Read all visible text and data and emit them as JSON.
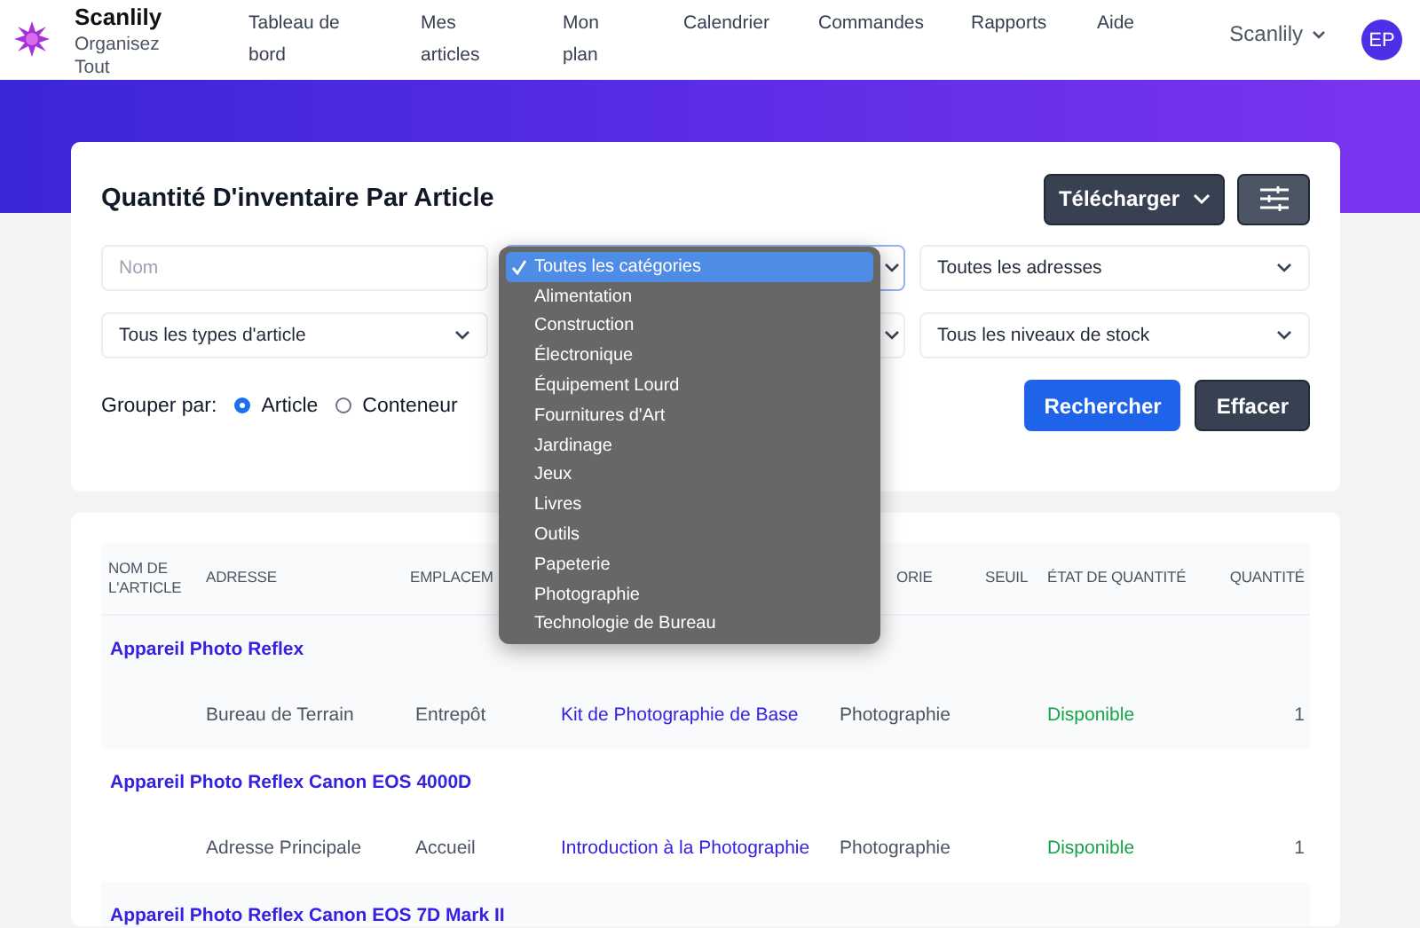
{
  "brand": {
    "name": "Scanlily",
    "tagline": "Organisez Tout"
  },
  "nav": [
    "Tableau de bord",
    "Mes articles",
    "Mon plan",
    "Calendrier",
    "Commandes",
    "Rapports",
    "Aide"
  ],
  "account": {
    "name": "Scanlily",
    "initials": "EP"
  },
  "report": {
    "title": "Quantité D'inventaire Par Article",
    "download": "Télécharger",
    "name_field": {
      "placeholder": "Nom"
    },
    "selects": [
      "Toutes les adresses",
      "Tous les types d'article",
      "Tous les niveaux de stock"
    ],
    "group_label": "Grouper par:",
    "group_options": [
      {
        "label": "Article",
        "selected": true
      },
      {
        "label": "Conteneur",
        "selected": false
      }
    ],
    "search": "Rechercher",
    "clear": "Effacer"
  },
  "category_menu": [
    {
      "label": "Toutes les catégories",
      "selected": true
    },
    {
      "label": "Alimentation",
      "selected": false
    },
    {
      "label": "Construction",
      "selected": false
    },
    {
      "label": "Électronique",
      "selected": false
    },
    {
      "label": "Équipement Lourd",
      "selected": false
    },
    {
      "label": "Fournitures d'Art",
      "selected": false
    },
    {
      "label": "Jardinage",
      "selected": false
    },
    {
      "label": "Jeux",
      "selected": false
    },
    {
      "label": "Livres",
      "selected": false
    },
    {
      "label": "Outils",
      "selected": false
    },
    {
      "label": "Papeterie",
      "selected": false
    },
    {
      "label": "Photographie",
      "selected": false
    },
    {
      "label": "Technologie de Bureau",
      "selected": false
    }
  ],
  "table": {
    "columns": [
      "NOM DE L'ARTICLE",
      "ADRESSE",
      "EMPLACEM",
      "",
      "ORIE",
      "SEUIL",
      "ÉTAT DE QUANTITÉ",
      "QUANTITÉ"
    ],
    "groups": [
      {
        "name": "Appareil Photo Reflex",
        "entries": [
          {
            "address": "Bureau de Terrain",
            "location": "Entrepôt",
            "container": "Kit de Photographie de Base",
            "category": "Photographie",
            "status": "Disponible",
            "quantity": "1"
          }
        ]
      },
      {
        "name": "Appareil Photo Reflex Canon EOS 4000D",
        "entries": [
          {
            "address": "Adresse Principale",
            "location": "Accueil",
            "container": "Introduction à la Photographie",
            "category": "Photographie",
            "status": "Disponible",
            "quantity": "1"
          }
        ]
      },
      {
        "name": "Appareil Photo Reflex Canon EOS 7D Mark II"
      }
    ]
  }
}
